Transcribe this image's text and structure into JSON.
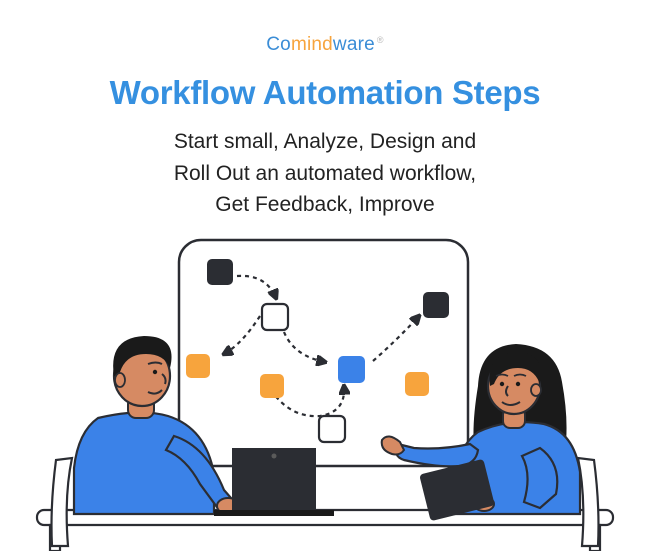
{
  "logo": {
    "part1": "Co",
    "part2": "mind",
    "part3": "ware",
    "reg": "®"
  },
  "title": "Workflow Automation Steps",
  "subtitle_line1": "Start small, Analyze, Design and",
  "subtitle_line2": "Roll Out  an automated workflow,",
  "subtitle_line3": "Get Feedback, Improve",
  "colors": {
    "blue": "#3590e0",
    "orange": "#f7a43d",
    "dark": "#2b2d33",
    "skin": "#d68a63",
    "hair": "#1a1a1a",
    "shirt": "#3b82e8",
    "desk": "#dedede"
  },
  "diagram_nodes": [
    {
      "id": "n1",
      "color": "dark"
    },
    {
      "id": "n2",
      "color": "white"
    },
    {
      "id": "n3",
      "color": "orange"
    },
    {
      "id": "n4",
      "color": "orange"
    },
    {
      "id": "n5",
      "color": "blue"
    },
    {
      "id": "n6",
      "color": "white"
    },
    {
      "id": "n7",
      "color": "dark"
    },
    {
      "id": "n8",
      "color": "orange"
    }
  ]
}
